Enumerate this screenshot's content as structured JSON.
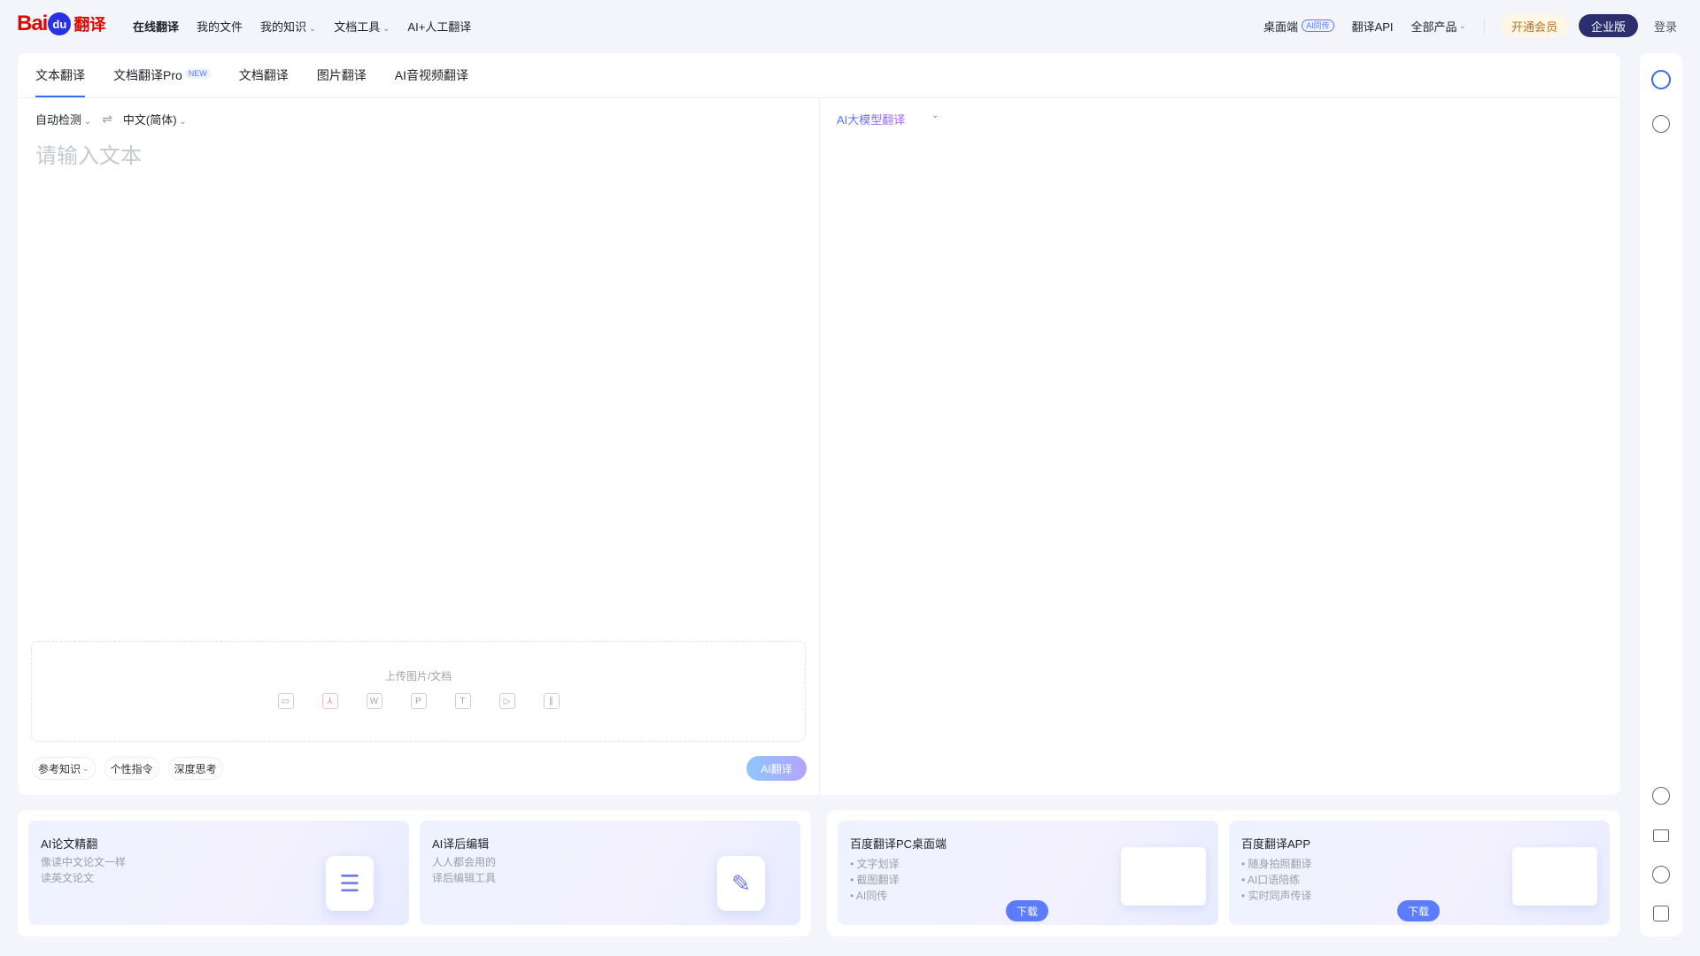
{
  "header": {
    "logo": {
      "bai": "Bai",
      "du": "du",
      "fanyi": "翻译"
    },
    "nav": [
      "在线翻译",
      "我的文件",
      "我的知识",
      "文档工具",
      "AI+人工翻译"
    ],
    "right": {
      "desktop": "桌面端",
      "desktop_badge": "AI同传",
      "api": "翻译API",
      "all_products": "全部产品",
      "vip": "开通会员",
      "enterprise": "企业版",
      "login": "登录"
    }
  },
  "tabs": [
    "文本翻译",
    "文档翻译Pro",
    "文档翻译",
    "图片翻译",
    "AI音视频翻译"
  ],
  "tab_new_badge": "NEW",
  "source": {
    "lang_from": "自动检测",
    "lang_to": "中文(简体)",
    "placeholder": "请输入文本",
    "upload_label": "上传图片/文档"
  },
  "bottom_chips": [
    "参考知识",
    "个性指令",
    "深度思考"
  ],
  "translate_button": "AI翻译",
  "target": {
    "model": "AI大模型翻译"
  },
  "cards": [
    {
      "title": "AI论文精翻",
      "lines": [
        "像读中文论文一样",
        "读英文论文"
      ]
    },
    {
      "title": "AI译后编辑",
      "lines": [
        "人人都会用的",
        "译后编辑工具"
      ]
    },
    {
      "title": "百度翻译PC桌面端",
      "lines": [
        "• 文字划译",
        "• 截图翻译",
        "• AI同传"
      ],
      "button": "下载"
    },
    {
      "title": "百度翻译APP",
      "lines": [
        "• 随身拍照翻译",
        "• AI口语陪练",
        "• 实时同声传译"
      ],
      "button": "下载"
    }
  ],
  "colors": {
    "accent": "#3a6cf4",
    "brand_red": "#e10601",
    "enterprise_bg": "#2b2f6e"
  }
}
